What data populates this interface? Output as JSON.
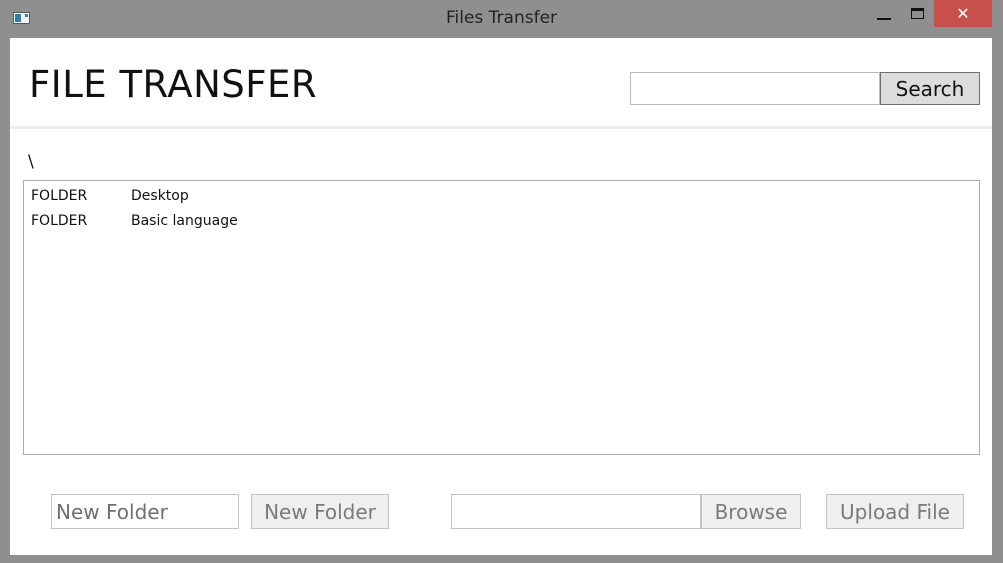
{
  "window": {
    "title": "Files Transfer",
    "close_glyph": "✕",
    "icons": [
      "app-icon",
      "minimize-icon",
      "maximize-icon",
      "close-icon"
    ]
  },
  "header": {
    "app_title": "FILE TRANSFER",
    "search": {
      "value": "",
      "placeholder": "",
      "button_label": "Search"
    }
  },
  "browser": {
    "current_path": "\\",
    "items": [
      {
        "type": "FOLDER",
        "name": "Desktop"
      },
      {
        "type": "FOLDER",
        "name": "Basic language"
      }
    ]
  },
  "actions": {
    "new_folder_input": {
      "value": "",
      "placeholder": "New Folder"
    },
    "new_folder_button": "New Folder",
    "upload_path_input": {
      "value": "",
      "placeholder": ""
    },
    "browse_button": "Browse",
    "upload_button": "Upload File"
  },
  "colors": {
    "titlebar": "#8f8f8f",
    "close_button": "#c7504d",
    "search_button": "#dcdcdc",
    "disabled_button": "#efefef"
  }
}
